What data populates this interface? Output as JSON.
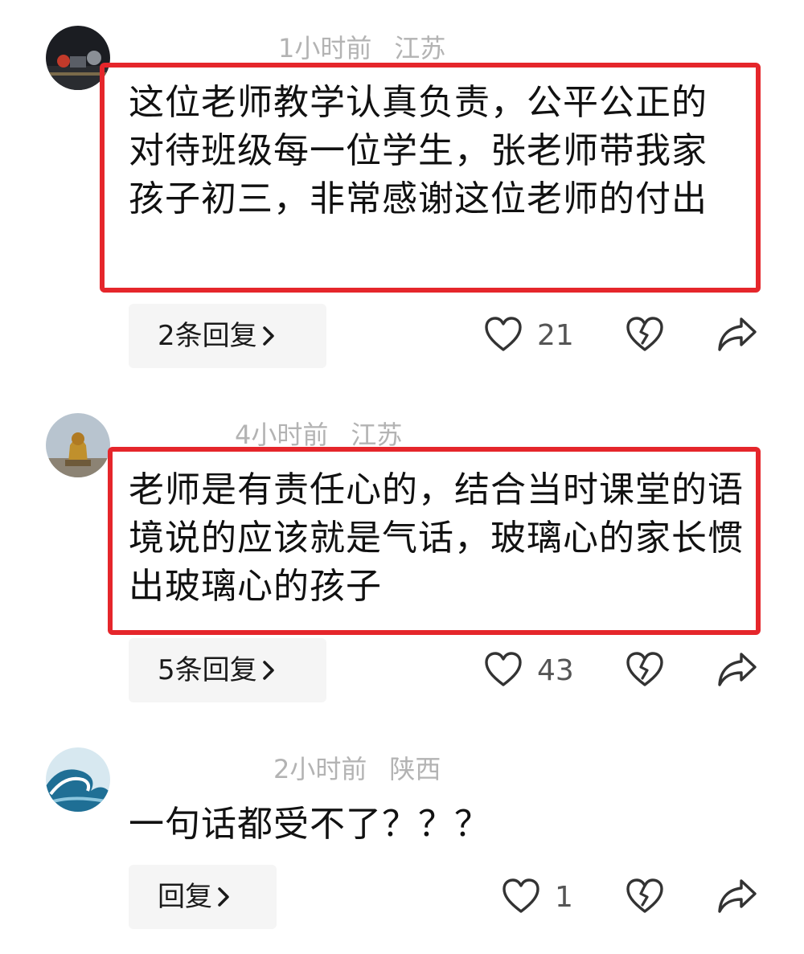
{
  "comments": [
    {
      "username": "",
      "time": "1小时前",
      "location": "江苏",
      "text": "这位老师教学认真负责，公平公正的对待班级每一位学生，张老师带我家孩子初三，非常感谢这位老师的付出",
      "reply_label": "2条回复",
      "likes": "21"
    },
    {
      "username": "",
      "time": "4小时前",
      "location": "江苏",
      "text": "老师是有责任心的，结合当时课堂的语境说的应该就是气话，玻璃心的家长惯出玻璃心的孩子",
      "reply_label": "5条回复",
      "likes": "43"
    },
    {
      "username": "",
      "time": "2小时前",
      "location": "陕西",
      "text": "一句话都受不了？？？",
      "reply_label": "回复",
      "likes": "1"
    }
  ],
  "icons": {
    "like": "heart-outline-icon",
    "dislike": "broken-heart-icon",
    "share": "share-arrow-icon",
    "chevron": "chevron-right-icon"
  },
  "colors": {
    "highlight_border": "#e5262b",
    "meta_text": "#b3b3b3",
    "reply_bg": "#f5f5f5"
  }
}
